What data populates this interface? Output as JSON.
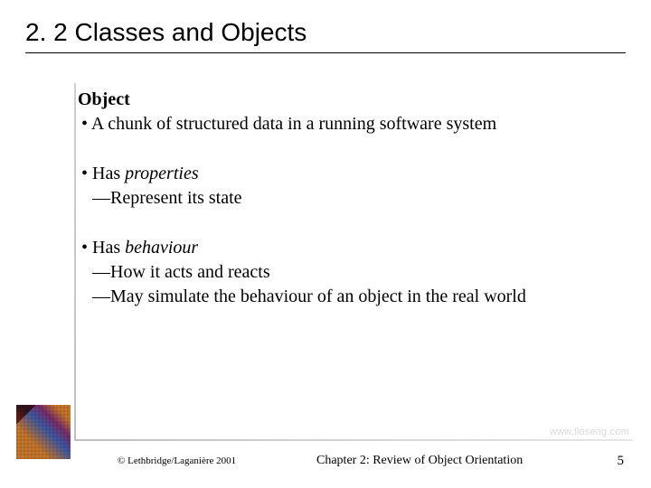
{
  "title": "2. 2 Classes and Objects",
  "term": "Object",
  "blocks": [
    {
      "level1": "A chunk of structured data in a running software system",
      "level2": []
    },
    {
      "level1_prefix": "Has ",
      "level1_italic": "properties",
      "level2": [
        "Represent its state"
      ]
    },
    {
      "level1_prefix": "Has ",
      "level1_italic": "behaviour",
      "level2": [
        "How it acts and reacts",
        "May simulate the behaviour of an object in the real world"
      ]
    }
  ],
  "footer": {
    "copyright": "© Lethbridge/Laganière 2001",
    "chapter": "Chapter 2: Review of Object Orientation",
    "page": "5"
  },
  "watermark": "www.lloseng.com"
}
